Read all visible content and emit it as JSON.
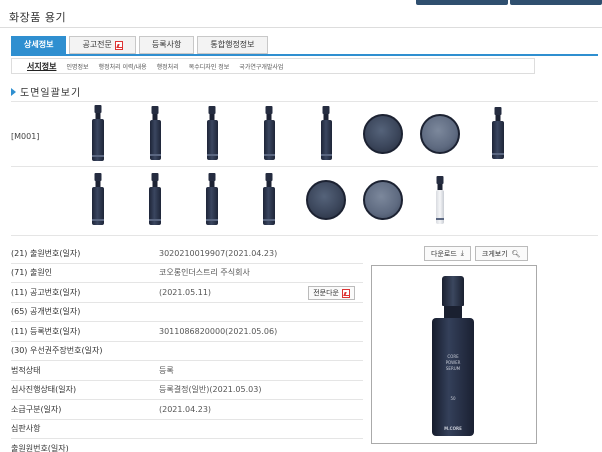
{
  "page": {
    "title": "화장품 용기"
  },
  "tabs": [
    {
      "label": "상세정보",
      "active": true
    },
    {
      "label": "공고전문",
      "pdf": true
    },
    {
      "label": "등록사항"
    },
    {
      "label": "통합행정정보"
    }
  ],
  "subtabs": [
    {
      "label": "서지정보",
      "active": true
    },
    {
      "label": "인명정보"
    },
    {
      "label": "행정처리 이력/내용"
    },
    {
      "label": "행정처리"
    },
    {
      "label": "복수디자인 정보"
    },
    {
      "label": "국가연구개발사업"
    }
  ],
  "drawings": {
    "heading": "도면일괄보기",
    "model": "[M001]"
  },
  "info_rows": [
    {
      "label": "(21) 출원번호(일자)",
      "value": "3020210019907(2021.04.23)"
    },
    {
      "label": "(71) 출원인",
      "value": "코오롱인더스트리 주식회사"
    },
    {
      "label": "(11) 공고번호(일자)",
      "value": "(2021.05.11)",
      "button": "전문다운"
    },
    {
      "label": "(65) 공개번호(일자)",
      "value": ""
    },
    {
      "label": "(11) 등록번호(일자)",
      "value": "3011086820000(2021.05.06)"
    },
    {
      "label": "(30) 우선권주장번호(일자)",
      "value": ""
    },
    {
      "label": "법적상태",
      "value": "등록"
    },
    {
      "label": "심사진행상태(일자)",
      "value": "등록결정(일반)(2021.05.03)"
    },
    {
      "label": "소급구분(일자)",
      "value": "(2021.04.23)"
    },
    {
      "label": "심판사항",
      "value": ""
    },
    {
      "label": "출원원번호(일자)",
      "value": ""
    }
  ],
  "buttons": {
    "download": "다운로드",
    "zoom": "크게보기"
  },
  "product": {
    "line1": "CORE",
    "line2": "POWER",
    "line3": "SERUM",
    "brand": "M.CORE",
    "size": "50"
  },
  "colors": {
    "accent": "#2f8fd0",
    "pdf": "#d33333",
    "bottle": "#222a3c"
  }
}
